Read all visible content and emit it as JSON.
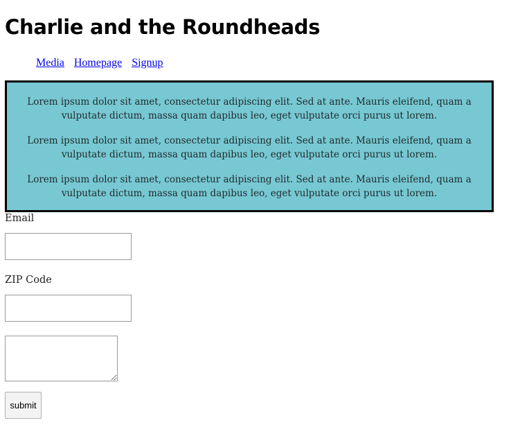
{
  "page": {
    "title": "Charlie and the Roundheads"
  },
  "nav": {
    "links": [
      {
        "label": "Media"
      },
      {
        "label": "Homepage"
      },
      {
        "label": "Signup"
      }
    ]
  },
  "content": {
    "paragraphs": [
      "Lorem ipsum dolor sit amet, consectetur adipiscing elit. Sed at ante. Mauris eleifend, quam a vulputate dictum, massa quam dapibus leo, eget vulputate orci purus ut lorem.",
      "Lorem ipsum dolor sit amet, consectetur adipiscing elit. Sed at ante. Mauris eleifend, quam a vulputate dictum, massa quam dapibus leo, eget vulputate orci purus ut lorem.",
      "Lorem ipsum dolor sit amet, consectetur adipiscing elit. Sed at ante. Mauris eleifend, quam a vulputate dictum, massa quam dapibus leo, eget vulputate orci purus ut lorem."
    ],
    "box_color": "#77c8d3"
  },
  "form": {
    "email_label": "Email",
    "email_value": "",
    "zip_label": "ZIP Code",
    "zip_value": "",
    "message_value": "",
    "submit_label": "submit"
  },
  "colors": {
    "link": "#0000ee",
    "box_border": "#000000"
  }
}
